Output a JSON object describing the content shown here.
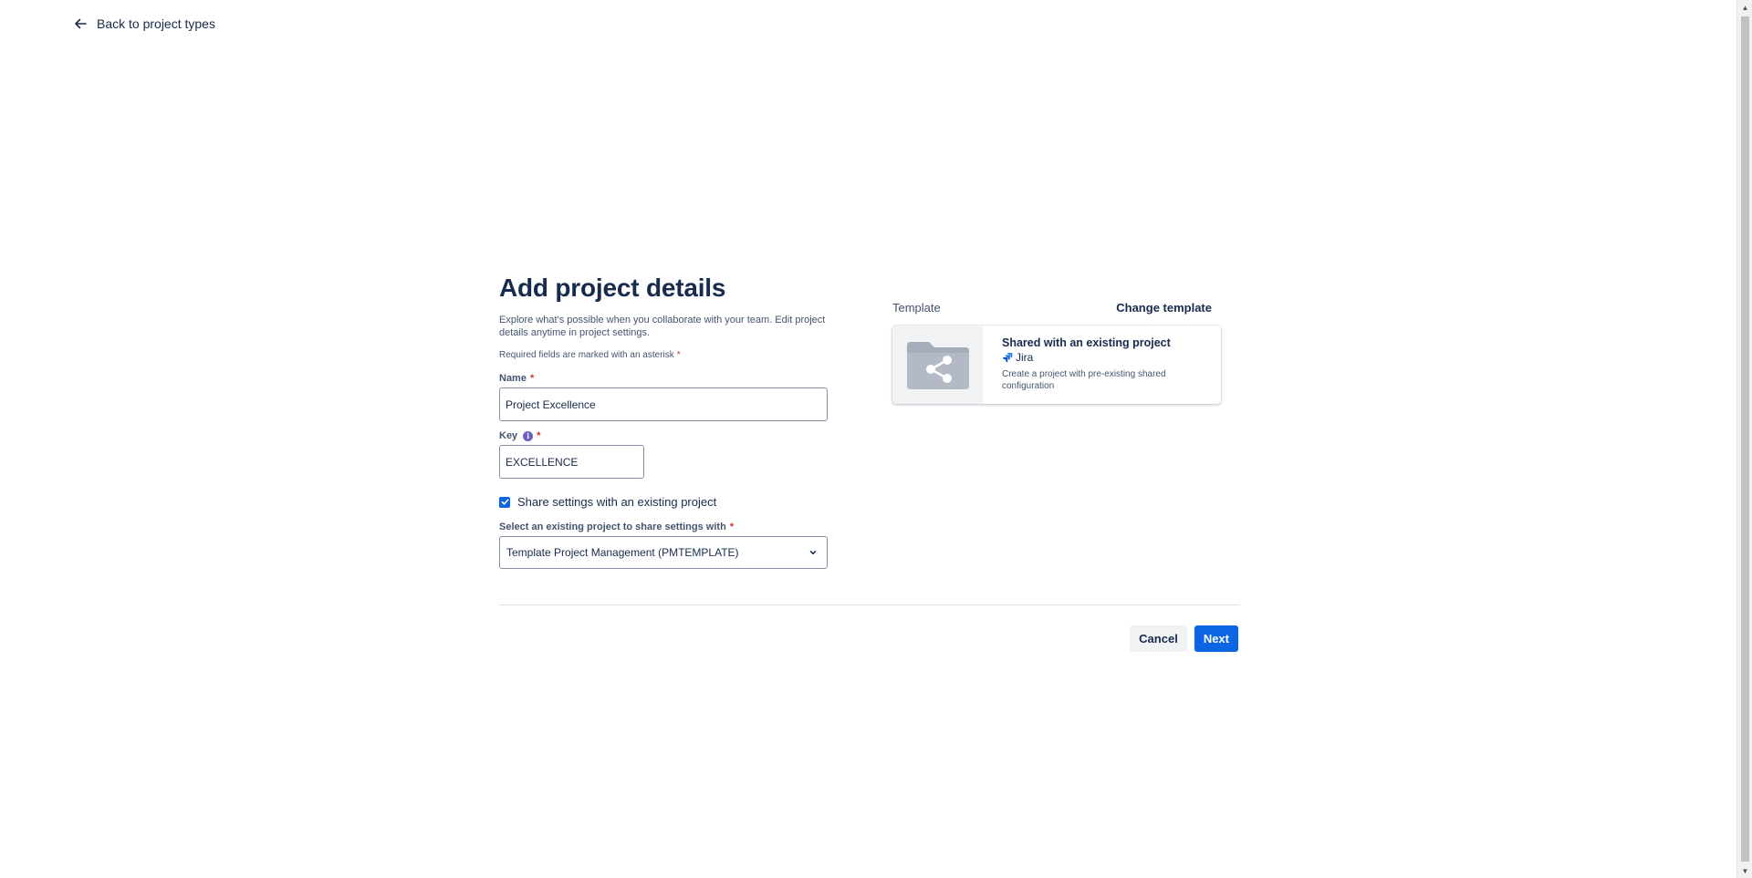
{
  "nav": {
    "back_label": "Back to project types"
  },
  "form": {
    "title": "Add project details",
    "intro": "Explore what's possible when you collaborate with your team. Edit project details anytime in project settings.",
    "required_note": "Required fields are marked with an asterisk",
    "asterisk": "*",
    "name_label": "Name",
    "name_value": "Project Excellence",
    "key_label": "Key",
    "key_value": "EXCELLENCE",
    "share_checkbox_label": "Share settings with an existing project",
    "share_checkbox_checked": true,
    "select_label": "Select an existing project to share settings with",
    "select_value": "Template Project Management (PMTEMPLATE)"
  },
  "template": {
    "label": "Template",
    "change_label": "Change template",
    "card": {
      "name": "Shared with an existing project",
      "product": "Jira",
      "description": "Create a project with pre-existing shared configuration"
    }
  },
  "footer": {
    "cancel_label": "Cancel",
    "next_label": "Next"
  },
  "colors": {
    "primary": "#0c66e4",
    "text": "#172b4d",
    "subtle_text": "#44546f",
    "required": "#c9372c",
    "info": "#6e5dc6"
  },
  "icons": {
    "back": "arrow-left-icon",
    "key_info": "info-icon",
    "checkbox": "checkmark-icon",
    "select": "chevron-down-icon",
    "template": "folder-share-icon",
    "product": "jira-icon"
  }
}
